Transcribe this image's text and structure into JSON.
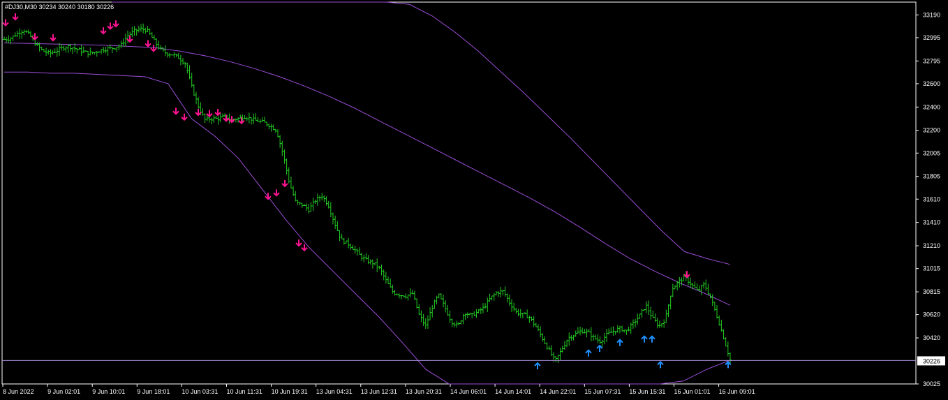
{
  "header": {
    "title": "#DJ30,M30  30234 30240 30180 30226"
  },
  "chart_data": {
    "type": "bar",
    "symbol": "#DJ30",
    "timeframe": "M30",
    "ohlc_last": {
      "open": 30234,
      "high": 30240,
      "low": 30180,
      "close": 30226
    },
    "ylim": [
      30025,
      33300
    ],
    "price_ticks": [
      33190,
      32995,
      32795,
      32600,
      32400,
      32200,
      32005,
      31805,
      31610,
      31410,
      31210,
      31015,
      30815,
      30620,
      30420,
      30025
    ],
    "current_price_label": "30226",
    "current_price": 30226,
    "time_ticks": [
      "8 Jun 2022",
      "9 Jun 02:01",
      "9 Jun 10:01",
      "9 Jun 18:01",
      "10 Jun 03:31",
      "10 Jun 11:31",
      "10 Jun 19:31",
      "13 Jun 04:31",
      "13 Jun 12:31",
      "13 Jun 20:31",
      "14 Jun 06:01",
      "14 Jun 14:01",
      "14 Jun 22:01",
      "15 Jun 07:31",
      "15 Jun 15:31",
      "16 Jun 01:01",
      "16 Jun 09:01"
    ],
    "close_series": [
      32980,
      32990,
      33030,
      33060,
      33010,
      32930,
      32880,
      32860,
      32880,
      32910,
      32920,
      32900,
      32880,
      32860,
      32870,
      32890,
      32900,
      32910,
      32930,
      33010,
      33050,
      33070,
      33060,
      32980,
      32900,
      32860,
      32850,
      32820,
      32770,
      32560,
      32400,
      32290,
      32300,
      32300,
      32320,
      32290,
      32300,
      32320,
      32300,
      32280,
      32270,
      32240,
      32200,
      32000,
      31750,
      31580,
      31560,
      31520,
      31600,
      31640,
      31560,
      31400,
      31260,
      31230,
      31180,
      31120,
      31080,
      31060,
      31010,
      30900,
      30810,
      30790,
      30780,
      30800,
      30620,
      30520,
      30680,
      30790,
      30680,
      30560,
      30520,
      30640,
      30610,
      30640,
      30680,
      30760,
      30810,
      30820,
      30720,
      30640,
      30620,
      30600,
      30520,
      30420,
      30320,
      30220,
      30320,
      30420,
      30450,
      30480,
      30470,
      30420,
      30390,
      30450,
      30480,
      30500,
      30480,
      30540,
      30610,
      30700,
      30590,
      30520,
      30580,
      30840,
      30900,
      30940,
      30880,
      30820,
      30880,
      30760,
      30600,
      30420,
      30230
    ],
    "buy_arrow_prices": [
      30240,
      30350,
      30390,
      30440,
      30470,
      30470,
      30250,
      30250
    ],
    "sell_arrow_prices": [
      33100,
      33150,
      32980,
      32970,
      33030,
      33070,
      33090,
      32960,
      32920,
      32880,
      32340,
      32290,
      32330,
      32320,
      32330,
      32280,
      32270,
      32260,
      31610,
      31640,
      31720,
      31210,
      31170,
      30940
    ],
    "envelopes": [
      {
        "name": "",
        "color": "#9b4dd6",
        "values": [
          33300,
          33300,
          33300,
          33300,
          33300,
          33300,
          33300,
          33300,
          33300,
          33300,
          33300,
          33300,
          33300,
          33280,
          33180,
          33040,
          32880,
          32700,
          32520,
          32330,
          32140,
          31940,
          31740,
          31540,
          31340,
          31160,
          31100,
          31050
        ]
      },
      {
        "name": "",
        "color": "#9b4dd6",
        "values": [
          32950,
          32945,
          32940,
          32935,
          32930,
          32920,
          32910,
          32880,
          32840,
          32790,
          32730,
          32660,
          32580,
          32490,
          32390,
          32280,
          32170,
          32060,
          31950,
          31840,
          31730,
          31620,
          31500,
          31370,
          31230,
          31100,
          30990,
          30890,
          30800,
          30700
        ]
      },
      {
        "name": "",
        "color": "#9b4dd6",
        "values": [
          32700,
          32700,
          32690,
          32690,
          32680,
          32670,
          32660,
          32600,
          32300,
          32150,
          31960,
          31700,
          31440,
          31200,
          31000,
          30800,
          30600,
          30380,
          30150,
          30000,
          30000,
          30000,
          30000,
          30000,
          30000,
          30000,
          30000,
          30000,
          30000,
          30050,
          30150,
          30230
        ]
      }
    ],
    "colors": {
      "background": "#000000",
      "bars": "#22cc22",
      "axis": "#ffffff",
      "buy_arrow": "#1e90ff",
      "sell_arrow": "#ff1493",
      "envelope": "#9b4dd6",
      "price_line": "#a58bd6"
    }
  }
}
